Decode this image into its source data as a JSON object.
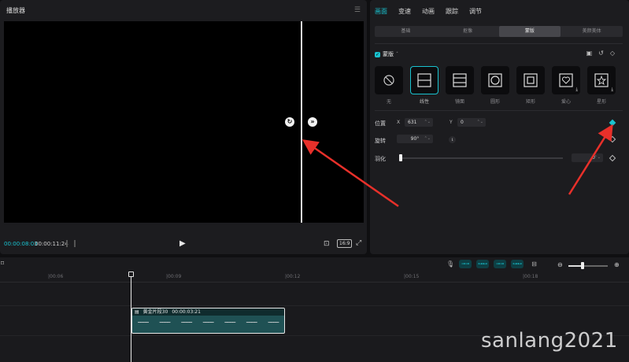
{
  "player": {
    "title": "播放器",
    "current_time": "00:00:08:03",
    "total_time": "00:00:11:24",
    "ratio": "16:9"
  },
  "properties": {
    "tabs": [
      "画面",
      "变速",
      "动画",
      "跟踪",
      "调节"
    ],
    "active_tab": 0,
    "subtabs": [
      "基础",
      "抠像",
      "蒙版",
      "美颜美体"
    ],
    "active_subtab": 2,
    "mask_label": "蒙版",
    "shapes": [
      "无",
      "线性",
      "镜面",
      "圆形",
      "矩形",
      "爱心",
      "星形"
    ],
    "active_shape": 1,
    "position_label": "位置",
    "x_label": "X",
    "x_value": "631",
    "y_label": "Y",
    "y_value": "0",
    "rotate_label": "旋转",
    "rotate_value": "90°",
    "feather_label": "羽化",
    "feather_value": "0"
  },
  "timeline": {
    "ticks": [
      "|00:06",
      "|00:09",
      "|00:12",
      "|00:15",
      "|00:18"
    ],
    "clip_name": "黄金片段30",
    "clip_duration": "00:00:03:21"
  },
  "watermark": "sanlang2021",
  "colors": {
    "accent": "#19c3d0",
    "arrow": "#e8302a"
  },
  "icons": [
    "menu-icon",
    "play-icon",
    "crop-icon",
    "fullscreen-icon",
    "rotate-handle-icon",
    "move-handle-icon",
    "keyframe-icon",
    "reset-icon",
    "microphone-icon",
    "zoom-in-icon",
    "zoom-out-icon"
  ]
}
